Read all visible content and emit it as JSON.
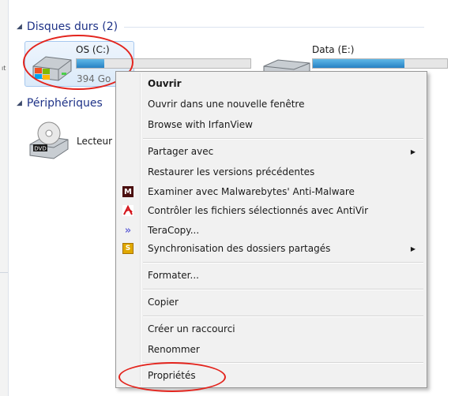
{
  "sections": {
    "hard_drives_header": "Disques durs (2)",
    "devices_header": "Périphériques"
  },
  "drives": [
    {
      "name": "OS (C:)",
      "free_text": "394 Go",
      "usage_fraction": 0.16
    },
    {
      "name": "Data (E:)",
      "usage_fraction": 0.68
    }
  ],
  "devices": [
    {
      "name": "Lecteur",
      "icon": "dvd-drive-icon",
      "icon_text": "DVD"
    }
  ],
  "context_menu": {
    "items": [
      {
        "label": "Ouvrir",
        "bold": true
      },
      {
        "label": "Ouvrir dans une nouvelle fenêtre"
      },
      {
        "label": "Browse with IrfanView"
      },
      {
        "label": "Partager avec",
        "submenu": true
      },
      {
        "label": "Restaurer les versions précédentes"
      },
      {
        "label": "Examiner avec Malwarebytes' Anti-Malware",
        "icon": "malwarebytes-icon",
        "icon_text": "M"
      },
      {
        "label": "Contrôler les fichiers sélectionnés avec AntiVir",
        "icon": "antivir-icon"
      },
      {
        "label": "TeraCopy...",
        "icon": "teracopy-icon",
        "icon_text": "»"
      },
      {
        "label": "Synchronisation des dossiers partagés",
        "icon": "sync-icon",
        "icon_text": "S",
        "submenu": true
      },
      {
        "label": "Formater..."
      },
      {
        "label": "Copier"
      },
      {
        "label": "Créer un raccourci"
      },
      {
        "label": "Renommer"
      },
      {
        "label": "Propriétés"
      }
    ],
    "submenu_arrow": "▶"
  },
  "colors": {
    "header_text": "#1e3287",
    "highlight_annotation": "#e3241d",
    "progress_fill": "#2782c4",
    "menu_background": "#f1f1f1"
  }
}
